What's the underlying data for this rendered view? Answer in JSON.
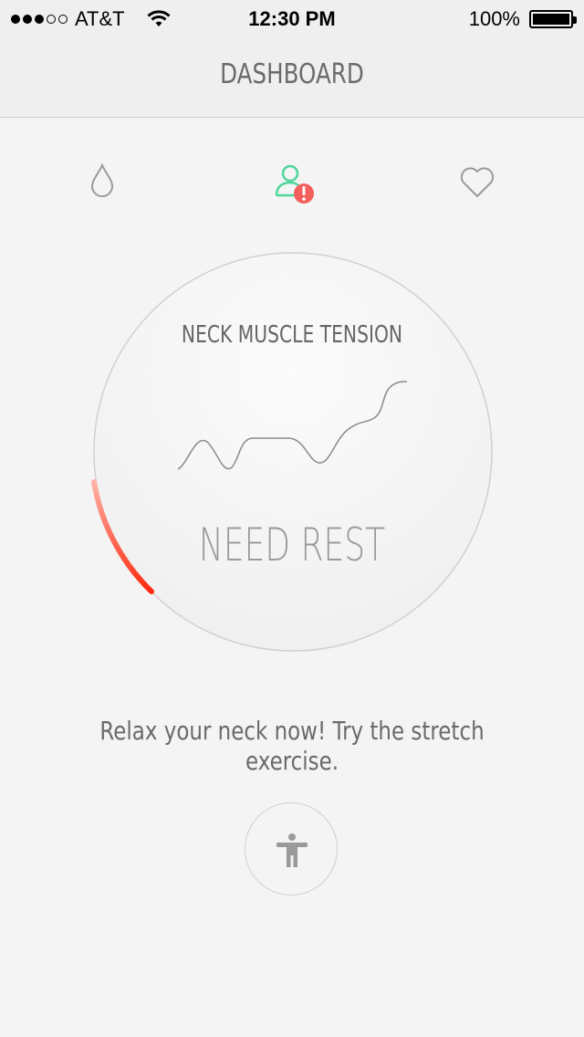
{
  "status_bar": {
    "signal_filled": 3,
    "signal_total": 5,
    "carrier": "AT&T",
    "time": "12:30 PM",
    "battery": "100%",
    "battery_level": 1.0
  },
  "nav": {
    "title": "DASHBOARD"
  },
  "tabs": [
    {
      "icon": "water-drop-icon",
      "active": false
    },
    {
      "icon": "person-alert-icon",
      "active": true,
      "alert": "!"
    },
    {
      "icon": "heart-icon",
      "active": false
    }
  ],
  "gauge": {
    "label": "NECK MUSCLE TENSION",
    "status": "NEED REST",
    "colors": {
      "ring": "#d0d0d0",
      "alert_start": "#ff2a10",
      "alert_end": "#ffb3a6"
    }
  },
  "message": "Relax your neck now! Try the stretch exercise.",
  "exercise_button": {
    "icon": "stretch-figure-icon"
  },
  "colors": {
    "active_tab": "#4fd69a",
    "alert_badge": "#f25f5c",
    "inactive_icon": "#9a9a9a"
  }
}
